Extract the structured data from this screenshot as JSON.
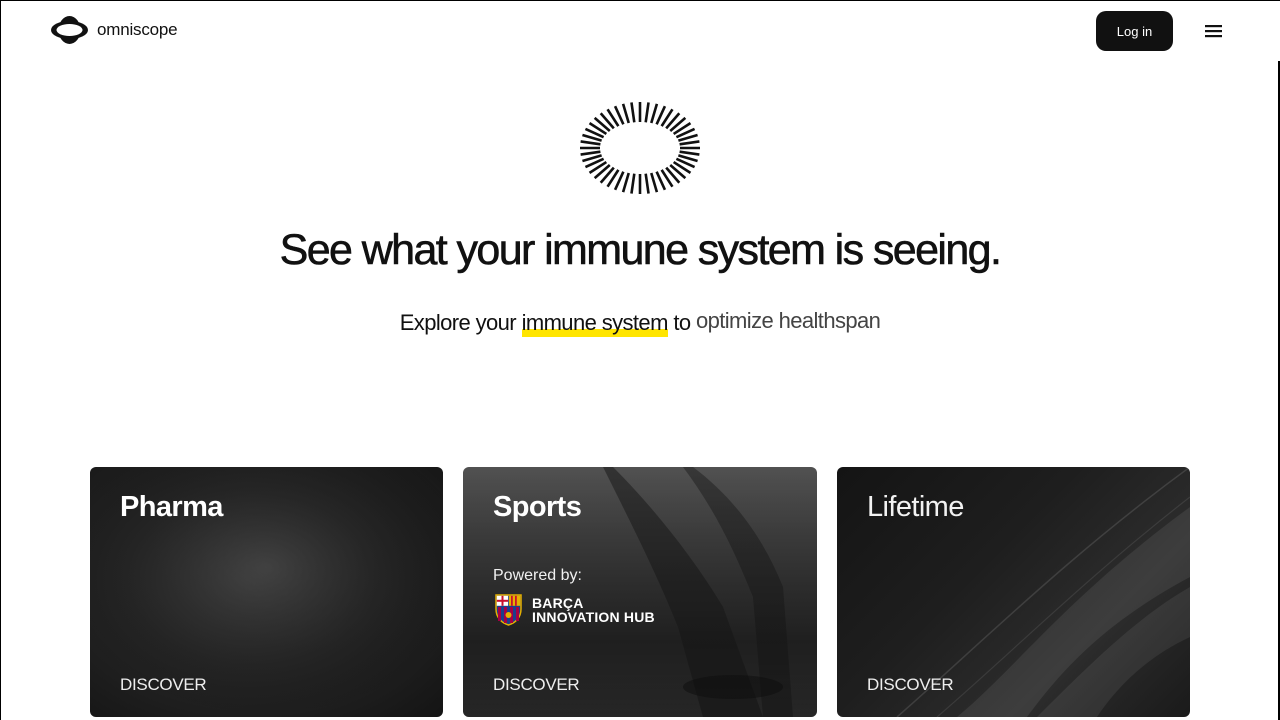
{
  "header": {
    "brand_name": "omniscope",
    "login_label": "Log in",
    "menu_icon": "hamburger-menu-icon"
  },
  "hero": {
    "logo_icon": "omniscope-eye-logo-icon",
    "headline": "See what your immune system is seeing.",
    "sub_prefix": "Explore your",
    "sub_highlight": "immune system",
    "sub_to": "to",
    "sub_rotating": "optimize healthspan",
    "highlight_color": "#ffe500"
  },
  "cards": [
    {
      "title": "Pharma",
      "cta": "DISCOVER"
    },
    {
      "title": "Sports",
      "powered_label": "Powered by:",
      "partner_line1": "BARÇA",
      "partner_line2": "INNOVATION HUB",
      "partner_icon": "fc-barcelona-crest-icon",
      "cta": "DISCOVER"
    },
    {
      "title": "Lifetime",
      "cta": "DISCOVER"
    }
  ]
}
